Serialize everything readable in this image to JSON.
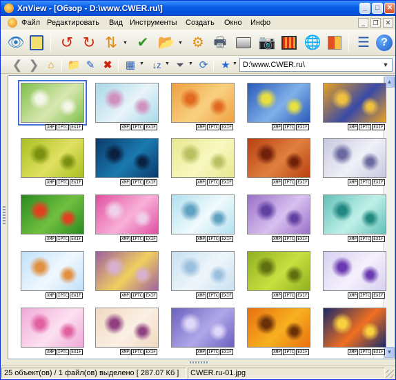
{
  "window": {
    "title": "XnView - [Обзор - D:\\www.CWER.ru\\]",
    "controls": [
      "minimize",
      "maximize",
      "close"
    ]
  },
  "menu": {
    "items": [
      "Файл",
      "Редактировать",
      "Вид",
      "Инструменты",
      "Создать",
      "Окно",
      "Инфо"
    ]
  },
  "toolbar": {
    "main_icons": [
      "eye-icon",
      "fullscreen-icon",
      "rotate-left-icon",
      "rotate-right-icon",
      "flip-icon",
      "checkmark-icon",
      "export-icon",
      "zoom-icon",
      "print-icon",
      "camera-icon",
      "filmstrip-icon",
      "globe-icon",
      "layout-icon",
      "settings-icon",
      "help-icon"
    ],
    "nav_icons": [
      "back-icon",
      "forward-icon",
      "up-folder-icon",
      "new-folder-icon",
      "rename-icon",
      "delete-icon",
      "view-mode-icon",
      "sort-icon",
      "filter-icon",
      "refresh-icon",
      "favorites-icon"
    ]
  },
  "address": {
    "path": "D:\\www.CWER.ru\\"
  },
  "thumbnails": {
    "tag_labels": [
      "XMP",
      "IPTC",
      "EXIF"
    ],
    "items": [
      {
        "selected": true,
        "colors": [
          "#7fbf4a",
          "#d8e8b0",
          "#f4f6e8"
        ]
      },
      {
        "selected": false,
        "colors": [
          "#a8d8e8",
          "#e8f4fa",
          "#d090c0"
        ]
      },
      {
        "selected": false,
        "colors": [
          "#f0a040",
          "#f8d080",
          "#e06a20"
        ]
      },
      {
        "selected": false,
        "colors": [
          "#2a5ab8",
          "#80b0e8",
          "#e8e040"
        ]
      },
      {
        "selected": false,
        "colors": [
          "#e8a020",
          "#3a4aa8",
          "#f0c040"
        ]
      },
      {
        "selected": false,
        "colors": [
          "#a8c020",
          "#e0e060",
          "#7a9010"
        ]
      },
      {
        "selected": false,
        "colors": [
          "#0a3a6a",
          "#1a7ab0",
          "#0a2040"
        ]
      },
      {
        "selected": false,
        "colors": [
          "#e8e890",
          "#f8f8c0",
          "#b8c060"
        ]
      },
      {
        "selected": false,
        "colors": [
          "#b84010",
          "#e08040",
          "#702008"
        ]
      },
      {
        "selected": false,
        "colors": [
          "#c8c8e0",
          "#f0f0f8",
          "#6a6aa0"
        ]
      },
      {
        "selected": false,
        "colors": [
          "#2a8a20",
          "#70c040",
          "#e04020"
        ]
      },
      {
        "selected": false,
        "colors": [
          "#e050a0",
          "#f8b0d8",
          "#f0d0e8"
        ]
      },
      {
        "selected": false,
        "colors": [
          "#b0e0f0",
          "#f0fafc",
          "#60a0c0"
        ]
      },
      {
        "selected": false,
        "colors": [
          "#9a70c8",
          "#d8c0f0",
          "#6040a0"
        ]
      },
      {
        "selected": false,
        "colors": [
          "#60c0b8",
          "#c0f0e8",
          "#208880"
        ]
      },
      {
        "selected": false,
        "colors": [
          "#c0e0f8",
          "#f0f8ff",
          "#e09040"
        ]
      },
      {
        "selected": false,
        "colors": [
          "#a060a0",
          "#f0d060",
          "#d8b0d0"
        ]
      },
      {
        "selected": false,
        "colors": [
          "#c8e0f0",
          "#eef6fa",
          "#9ac0e0"
        ]
      },
      {
        "selected": false,
        "colors": [
          "#90b020",
          "#c8e040",
          "#607010"
        ]
      },
      {
        "selected": false,
        "colors": [
          "#d8d0f0",
          "#f4f0fc",
          "#6a3ab0"
        ]
      },
      {
        "selected": false,
        "colors": [
          "#f0a8d8",
          "#fce0f0",
          "#e060a0"
        ]
      },
      {
        "selected": false,
        "colors": [
          "#f0d8c0",
          "#fbf0e4",
          "#904080"
        ]
      },
      {
        "selected": false,
        "colors": [
          "#6a60c0",
          "#b0a8e8",
          "#e0d8f8"
        ]
      },
      {
        "selected": false,
        "colors": [
          "#e87010",
          "#f8b020",
          "#6a3008"
        ]
      },
      {
        "selected": false,
        "colors": [
          "#1a2a6a",
          "#f07020",
          "#f8d040"
        ]
      }
    ]
  },
  "status": {
    "selection": "25 объект(ов) / 1 файл(ов) выделено",
    "size": "[ 287.07 Кб ]",
    "filename": "CWER.ru-01.jpg"
  }
}
